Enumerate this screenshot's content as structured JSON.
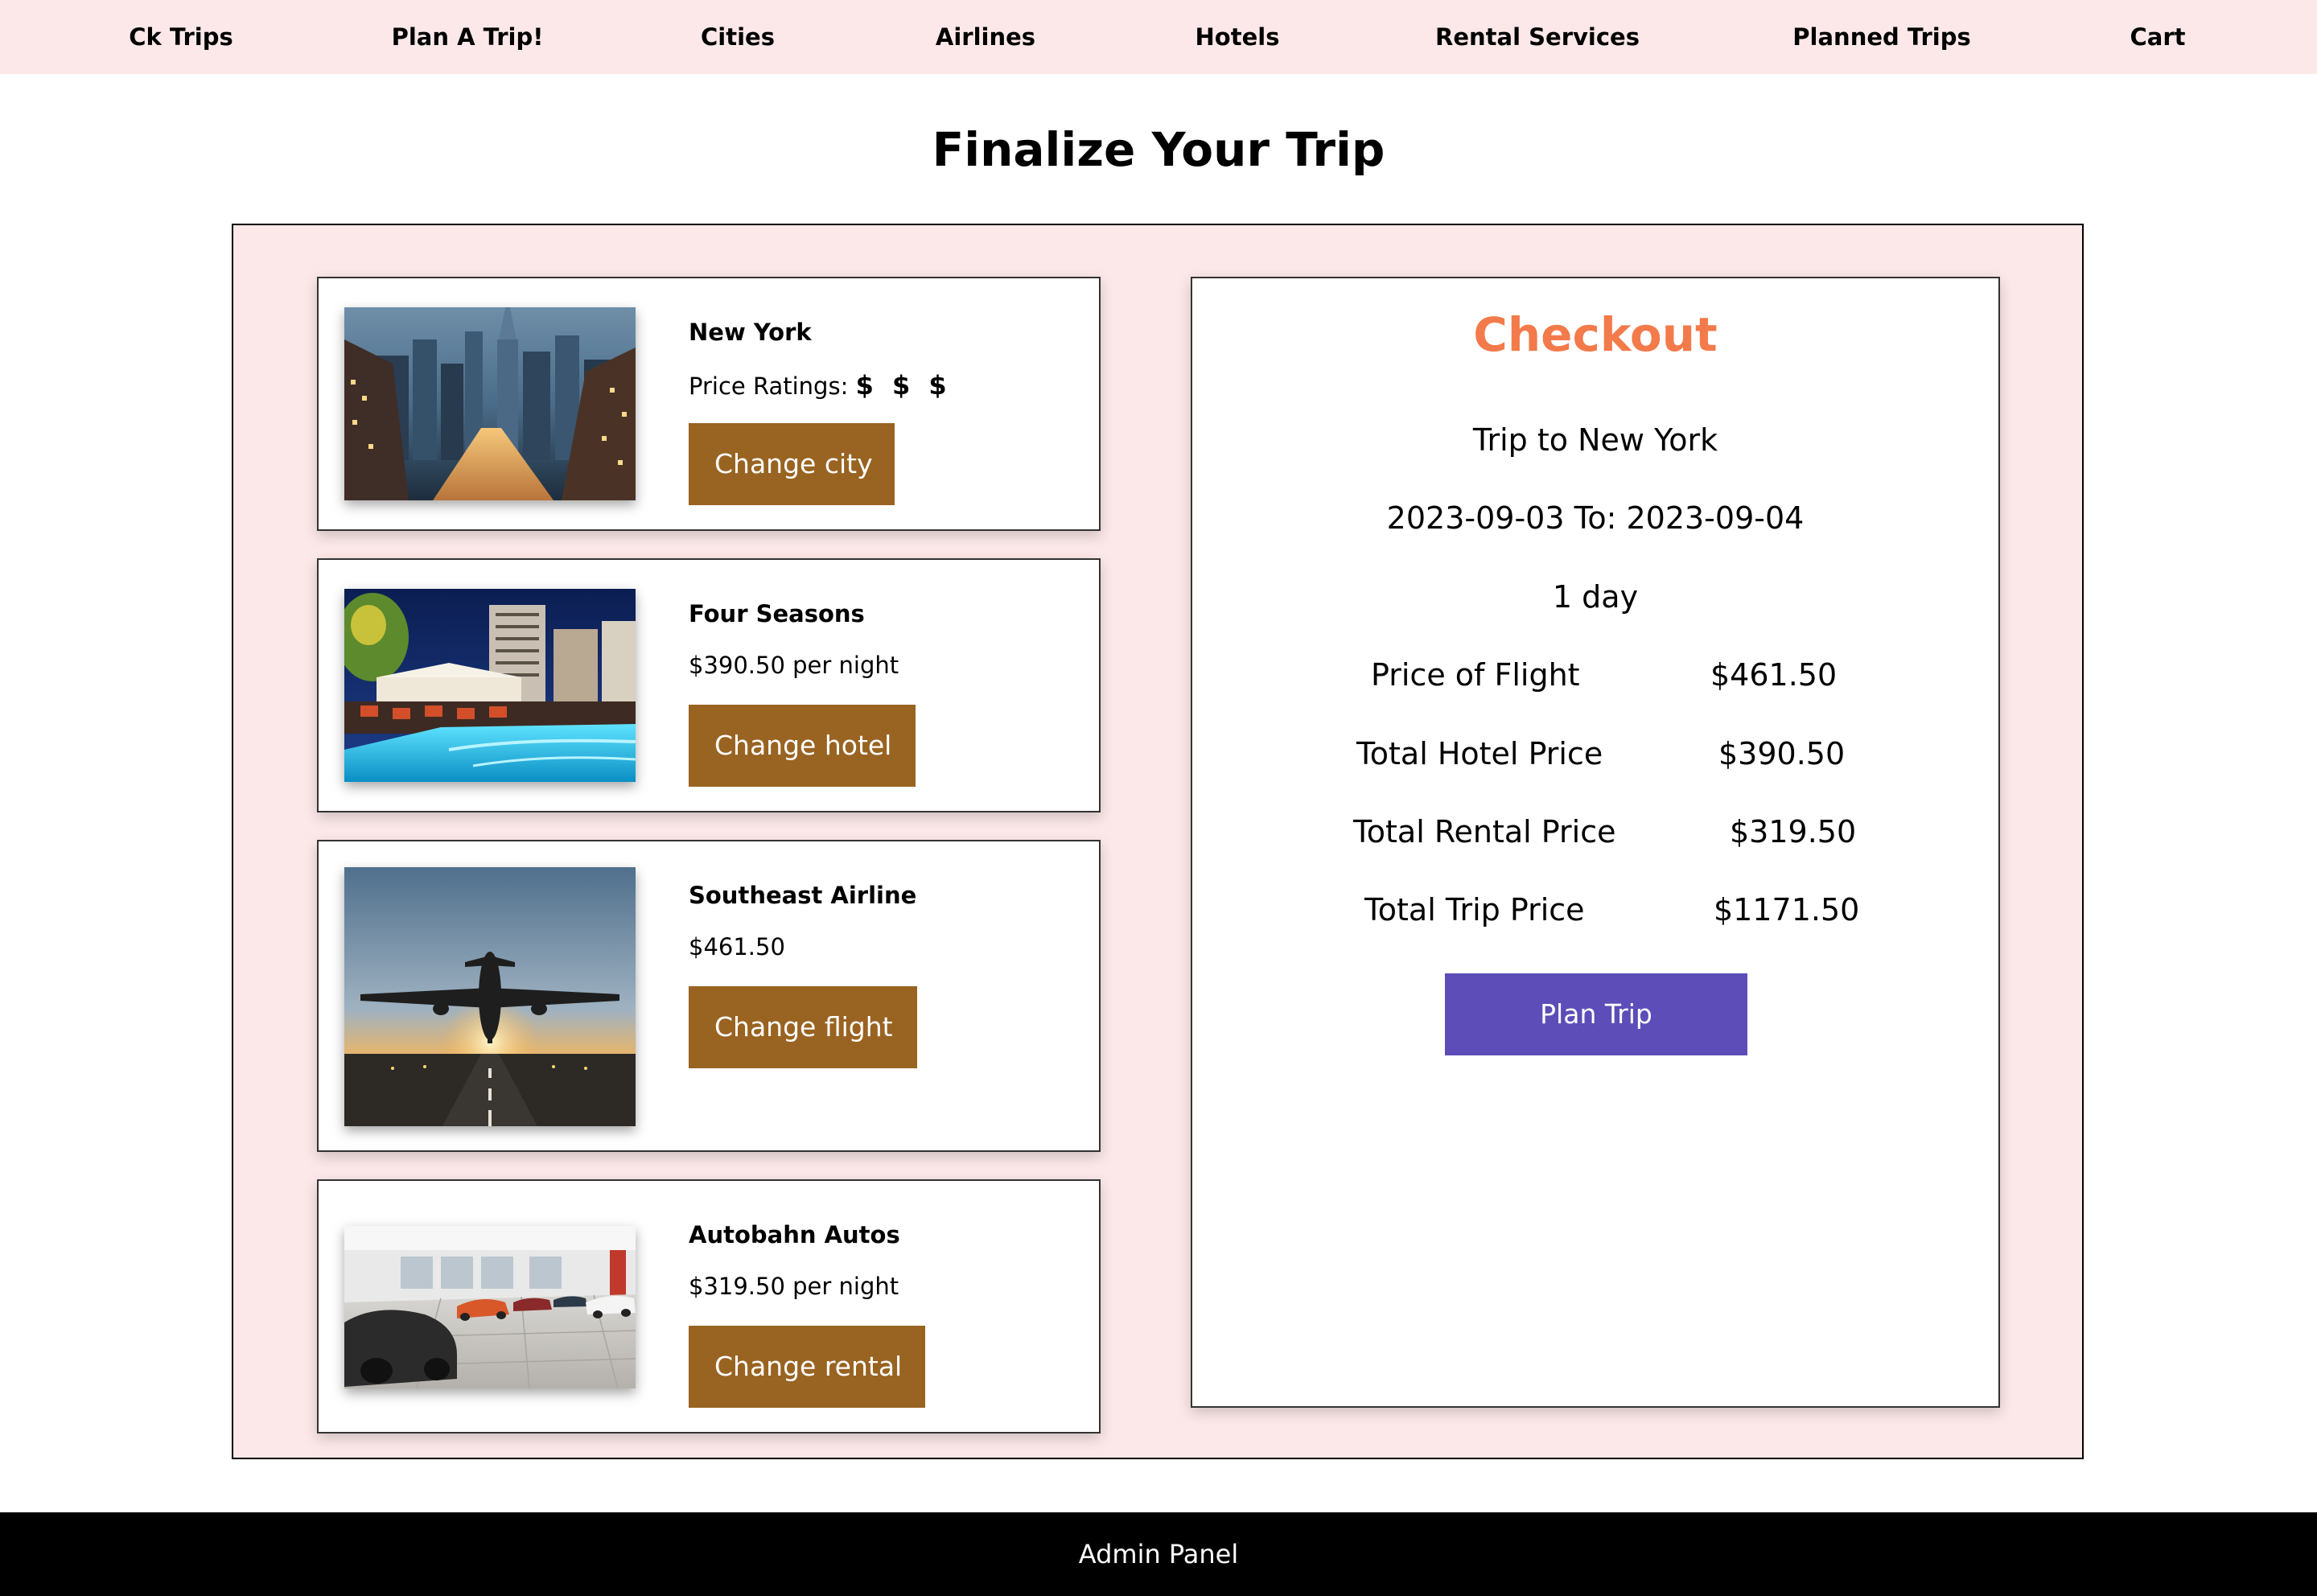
{
  "nav": {
    "items": [
      "Ck Trips",
      "Plan A Trip!",
      "Cities",
      "Airlines",
      "Hotels",
      "Rental Services",
      "Planned Trips",
      "Cart"
    ]
  },
  "page": {
    "title": "Finalize Your Trip"
  },
  "selections": {
    "city": {
      "name": "New York",
      "price_label": "Price Ratings:",
      "price_rating": "$ $ $",
      "button": "Change city",
      "image": "new-york-city-photo"
    },
    "hotel": {
      "name": "Four Seasons",
      "price": "$390.50 per night",
      "button": "Change hotel",
      "image": "hotel-pool-photo"
    },
    "flight": {
      "name": "Southeast Airline",
      "price": "$461.50",
      "button": "Change flight",
      "image": "airplane-runway-photo"
    },
    "rental": {
      "name": "Autobahn Autos",
      "price": "$319.50 per night",
      "button": "Change rental",
      "image": "car-showroom-photo"
    }
  },
  "checkout": {
    "title": "Checkout",
    "trip": "Trip to New York",
    "dates": "2023-09-03 To: 2023-09-04",
    "duration": "1 day",
    "rows": [
      {
        "label": "Price of Flight",
        "value": "$461.50"
      },
      {
        "label": "Total Hotel Price",
        "value": "$390.50"
      },
      {
        "label": "Total Rental Price",
        "value": "$319.50"
      },
      {
        "label": "Total Trip Price",
        "value": "$1171.50"
      }
    ],
    "button": "Plan Trip"
  },
  "footer": {
    "label": "Admin Panel"
  },
  "colors": {
    "nav_bg": "#fce8e8",
    "change_button": "#996321",
    "plan_button": "#5c4db8",
    "checkout_title": "#f37a4a"
  }
}
